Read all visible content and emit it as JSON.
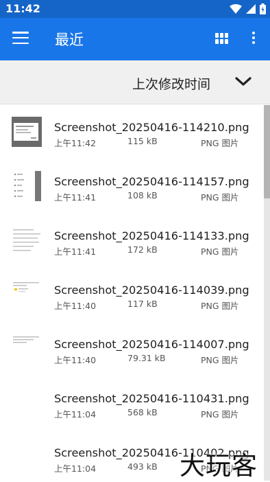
{
  "status_bar": {
    "time": "11:42",
    "icons": [
      "wifi-icon",
      "signal-icon",
      "battery-icon"
    ]
  },
  "app_bar": {
    "title": "最近",
    "icons": [
      "menu-icon",
      "grid-view-icon",
      "more-vert-icon"
    ]
  },
  "sort_bar": {
    "label": "上次修改时间"
  },
  "files": [
    {
      "name": "Screenshot_20250416-114210.png",
      "time": "上午11:42",
      "size": "115 kB",
      "type": "PNG 图片"
    },
    {
      "name": "Screenshot_20250416-114157.png",
      "time": "上午11:41",
      "size": "108 kB",
      "type": "PNG 图片"
    },
    {
      "name": "Screenshot_20250416-114133.png",
      "time": "上午11:41",
      "size": "172 kB",
      "type": "PNG 图片"
    },
    {
      "name": "Screenshot_20250416-114039.png",
      "time": "上午11:40",
      "size": "117 kB",
      "type": "PNG 图片"
    },
    {
      "name": "Screenshot_20250416-114007.png",
      "time": "上午11:40",
      "size": "79.31 kB",
      "type": "PNG 图片"
    },
    {
      "name": "Screenshot_20250416-110431.png",
      "time": "上午11:04",
      "size": "568 kB",
      "type": "PNG 图片"
    },
    {
      "name": "Screenshot_20250416-110402.png",
      "time": "上午11:04",
      "size": "493 kB",
      "type": "PNG 图片"
    }
  ],
  "watermark": "大玩客",
  "colors": {
    "status_bar": "#1564c8",
    "app_bar": "#1976e8",
    "sort_bar": "#f0f0f0"
  }
}
